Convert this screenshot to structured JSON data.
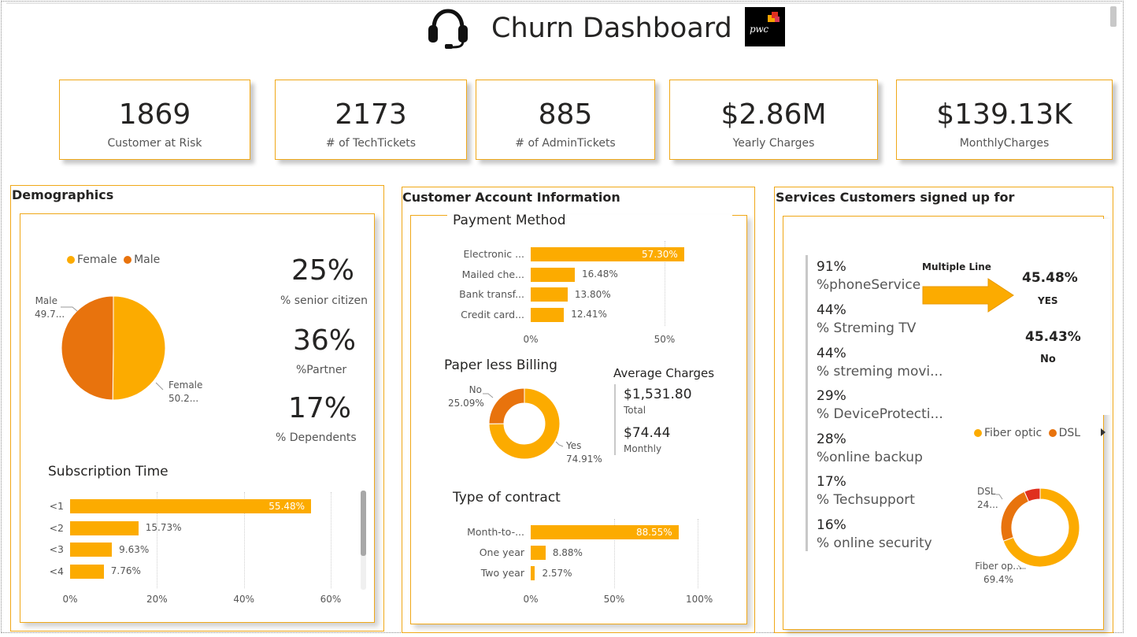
{
  "header": {
    "title": "Churn Dashboard",
    "logo_text": "pwc"
  },
  "kpis": [
    {
      "value": "1869",
      "label": "Customer at Risk"
    },
    {
      "value": "2173",
      "label": "# of TechTickets"
    },
    {
      "value": "885",
      "label": "# of  AdminTickets"
    },
    {
      "value": "$2.86M",
      "label": "Yearly Charges"
    },
    {
      "value": "$139.13K",
      "label": "MonthlyCharges"
    }
  ],
  "demographics": {
    "title": "Demographics",
    "gender_legend": [
      "Female",
      "Male"
    ],
    "gender_pie": {
      "male_label": "Male",
      "male_value": "49.7...",
      "female_label": "Female",
      "female_value": "50.2...",
      "female_share": 50.2
    },
    "stats": [
      {
        "value": "25%",
        "label": "% senior citizen"
      },
      {
        "value": "36%",
        "label": "%Partner"
      },
      {
        "value": "17%",
        "label": "% Dependents"
      }
    ],
    "subscription_title": "Subscription Time",
    "subscription_axis": [
      "0%",
      "20%",
      "40%",
      "60%"
    ]
  },
  "account": {
    "title": "Customer Account Information",
    "payment_title": "Payment Method",
    "payment_axis": [
      "0%",
      "50%"
    ],
    "paperless_title": "Paper less Billing",
    "paperless": {
      "no_label": "No",
      "no_value": "25.09%",
      "yes_label": "Yes",
      "yes_value": "74.91%",
      "yes_share": 74.91
    },
    "avg_title": "Average Charges",
    "avg": [
      {
        "value": "$1,531.80",
        "label": "Total"
      },
      {
        "value": "$74.44",
        "label": "Monthly"
      }
    ],
    "contract_title": "Type of contract",
    "contract_axis": [
      "0%",
      "50%",
      "100%"
    ]
  },
  "services": {
    "title": "Services Customers signed up for",
    "list": [
      {
        "pct": "91%",
        "label": "%phoneService"
      },
      {
        "pct": "44%",
        "label": "% Streming TV"
      },
      {
        "pct": "44%",
        "label": "% streming movi..."
      },
      {
        "pct": "29%",
        "label": "% DeviceProtecti..."
      },
      {
        "pct": "28%",
        "label": "%online backup"
      },
      {
        "pct": "17%",
        "label": "% Techsupport"
      },
      {
        "pct": "16%",
        "label": "% online security"
      }
    ],
    "multiple_line": {
      "label": "Multiple Line",
      "yes_value": "45.48%",
      "yes_label": "YES",
      "no_value": "45.43%",
      "no_label": "No"
    },
    "internet_legend": [
      "Fiber optic",
      "DSL"
    ],
    "internet": {
      "dsl_label": "DSL",
      "dsl_value": "24...",
      "fiber_label": "Fiber op...",
      "fiber_value": "69.4%",
      "fiber_share": 69.4,
      "dsl_share": 24.0
    }
  },
  "colors": {
    "accent": "#fcab00",
    "dark_orange": "#e8730d",
    "red": "#e0301e",
    "border": "#f0a818"
  },
  "chart_data": [
    {
      "type": "bar",
      "title": "Subscription Time",
      "categories": [
        "<1",
        "<2",
        "<3",
        "<4"
      ],
      "values": [
        55.48,
        15.73,
        9.63,
        7.76
      ],
      "labels": [
        "55.48%",
        "15.73%",
        "9.63%",
        "7.76%"
      ],
      "xlim": [
        0,
        60
      ],
      "orientation": "horizontal"
    },
    {
      "type": "bar",
      "title": "Payment Method",
      "categories": [
        "Electronic ...",
        "Mailed che...",
        "Bank transf...",
        "Credit card..."
      ],
      "values": [
        57.3,
        16.48,
        13.8,
        12.41
      ],
      "labels": [
        "57.30%",
        "16.48%",
        "13.80%",
        "12.41%"
      ],
      "xlim": [
        0,
        60
      ],
      "orientation": "horizontal"
    },
    {
      "type": "bar",
      "title": "Type of contract",
      "categories": [
        "Month-to-...",
        "One year",
        "Two year"
      ],
      "values": [
        88.55,
        8.88,
        2.57
      ],
      "labels": [
        "88.55%",
        "8.88%",
        "2.57%"
      ],
      "xlim": [
        0,
        100
      ],
      "orientation": "horizontal"
    }
  ]
}
